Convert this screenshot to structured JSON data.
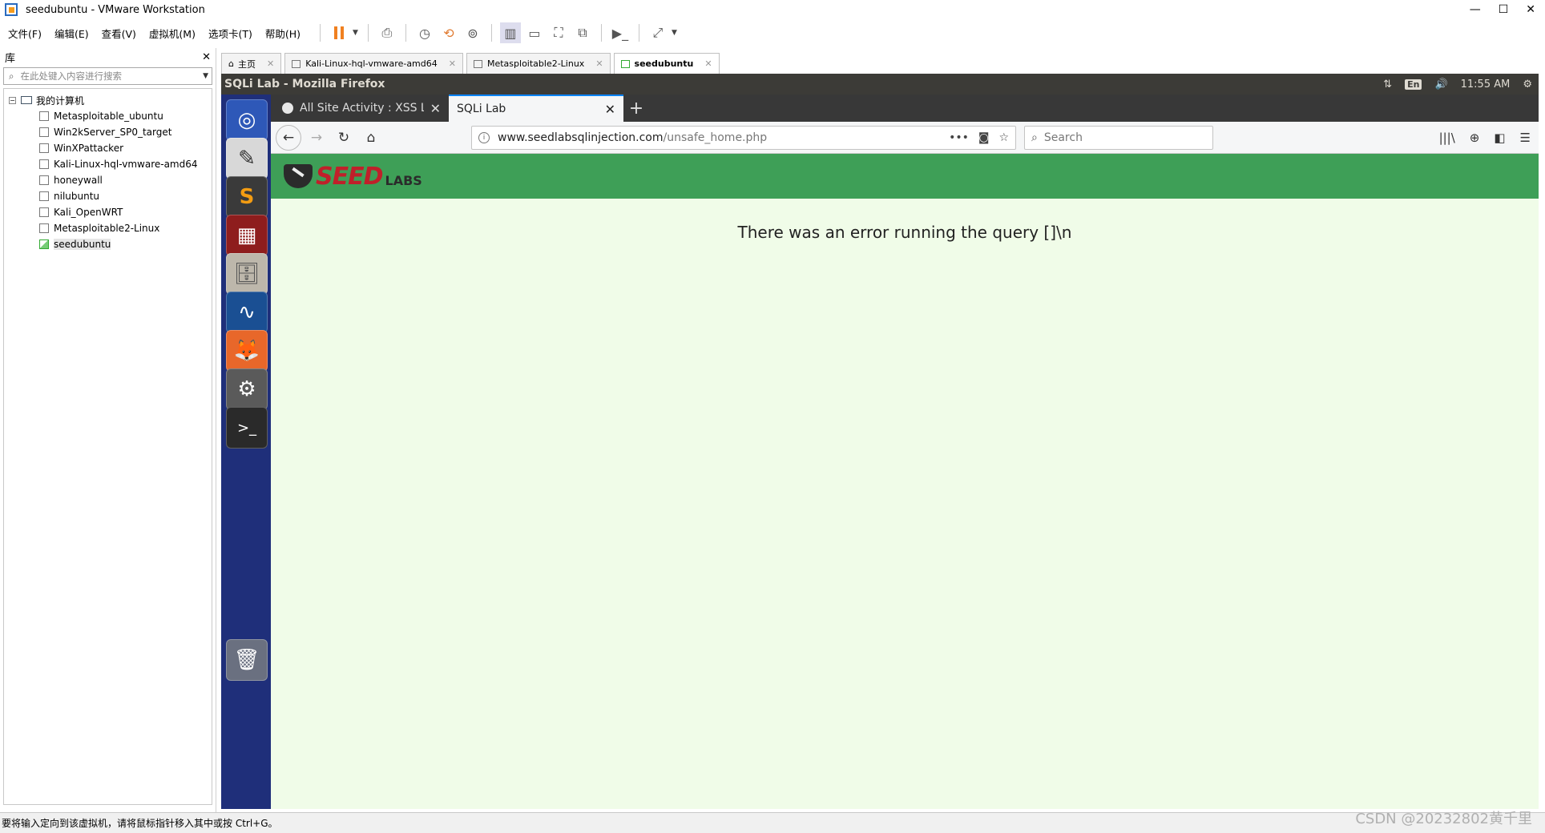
{
  "window": {
    "title": "seedubuntu - VMware Workstation",
    "controls": [
      "—",
      "☐",
      "✕"
    ]
  },
  "menubar": {
    "items": [
      "文件(F)",
      "编辑(E)",
      "查看(V)",
      "虚拟机(M)",
      "选项卡(T)",
      "帮助(H)"
    ]
  },
  "library": {
    "title": "库",
    "close": "✕",
    "search_placeholder": "在此处键入内容进行搜索",
    "root": "我的计算机",
    "items": [
      {
        "label": "Metasploitable_ubuntu",
        "running": false
      },
      {
        "label": "Win2kServer_SP0_target",
        "running": false
      },
      {
        "label": "WinXPattacker",
        "running": false
      },
      {
        "label": "Kali-Linux-hql-vmware-amd64",
        "running": false
      },
      {
        "label": "honeywall",
        "running": false
      },
      {
        "label": "nilubuntu",
        "running": false
      },
      {
        "label": "Kali_OpenWRT",
        "running": false
      },
      {
        "label": "Metasploitable2-Linux",
        "running": false
      },
      {
        "label": "seedubuntu",
        "running": true
      }
    ]
  },
  "vm_tabs": [
    {
      "label": "主页",
      "active": false
    },
    {
      "label": "Kali-Linux-hql-vmware-amd64",
      "active": false
    },
    {
      "label": "Metasploitable2-Linux",
      "active": false
    },
    {
      "label": "seedubuntu",
      "active": true
    }
  ],
  "ubuntu": {
    "window_title": "SQLi Lab - Mozilla Firefox",
    "lang": "En",
    "time": "11:55 AM"
  },
  "firefox": {
    "tabs": [
      {
        "label": "All Site Activity : XSS Lab",
        "active": false
      },
      {
        "label": "SQLi Lab",
        "active": true
      }
    ],
    "url_host": "www.seedlabsqlinjection.com",
    "url_path": "/unsafe_home.php",
    "search_placeholder": "Search"
  },
  "page": {
    "logo_seed": "SEED",
    "logo_labs": "LABS",
    "error_message": "There was an error running the query []\\n"
  },
  "statusbar": {
    "text": "要将输入定向到该虚拟机，请将鼠标指针移入其中或按 Ctrl+G。"
  },
  "watermark": "CSDN @20232802黄千里",
  "colors": {
    "seed_header": "#3e9f57",
    "page_bg": "#f0fce8",
    "launcher": "#1f2f7a",
    "ubuntu_panel": "#3c3b37"
  }
}
